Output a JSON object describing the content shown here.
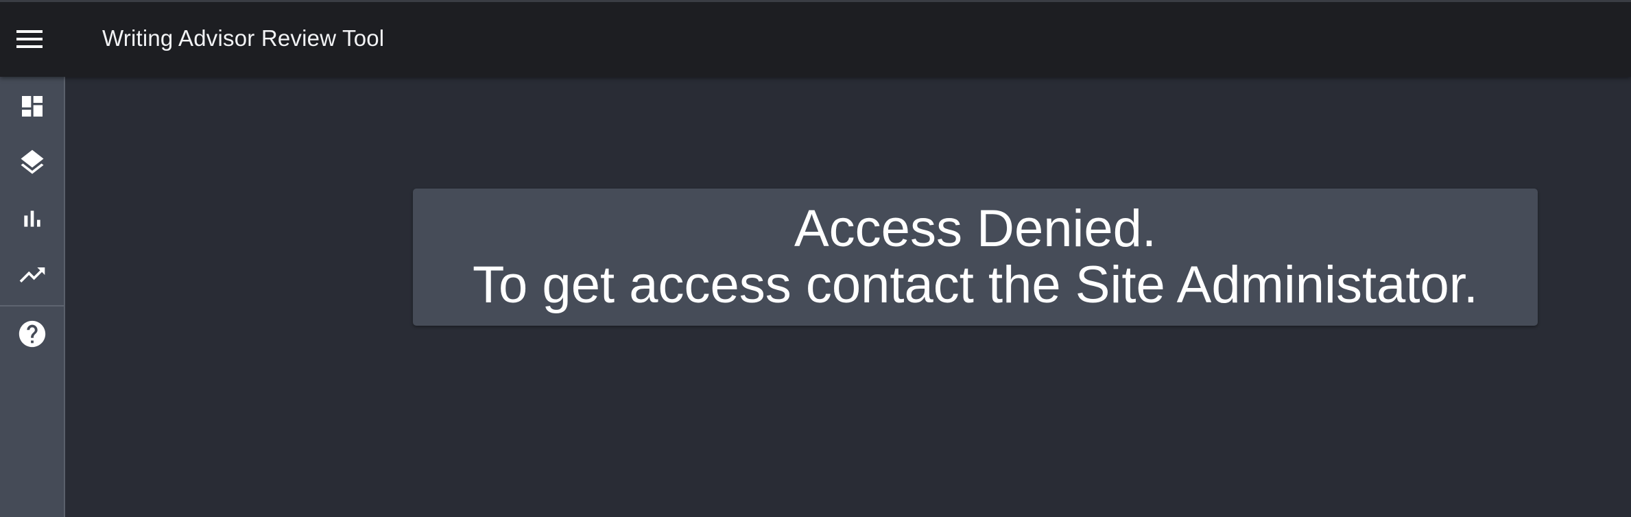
{
  "header": {
    "title": "Writing Advisor Review Tool",
    "menu_icon": "menu-icon"
  },
  "sidebar": {
    "items": [
      {
        "icon": "dashboard-icon"
      },
      {
        "icon": "layers-icon"
      },
      {
        "icon": "bar-chart-icon"
      },
      {
        "icon": "trending-up-icon"
      },
      {
        "icon": "help-icon"
      }
    ]
  },
  "message": {
    "line1": "Access Denied.",
    "line2": "To get access contact the Site Administator."
  },
  "colors": {
    "header_bg": "#1d1e22",
    "sidebar_bg": "#454b57",
    "main_bg": "#292c35",
    "message_bg": "#464c58",
    "text": "#ffffff"
  }
}
